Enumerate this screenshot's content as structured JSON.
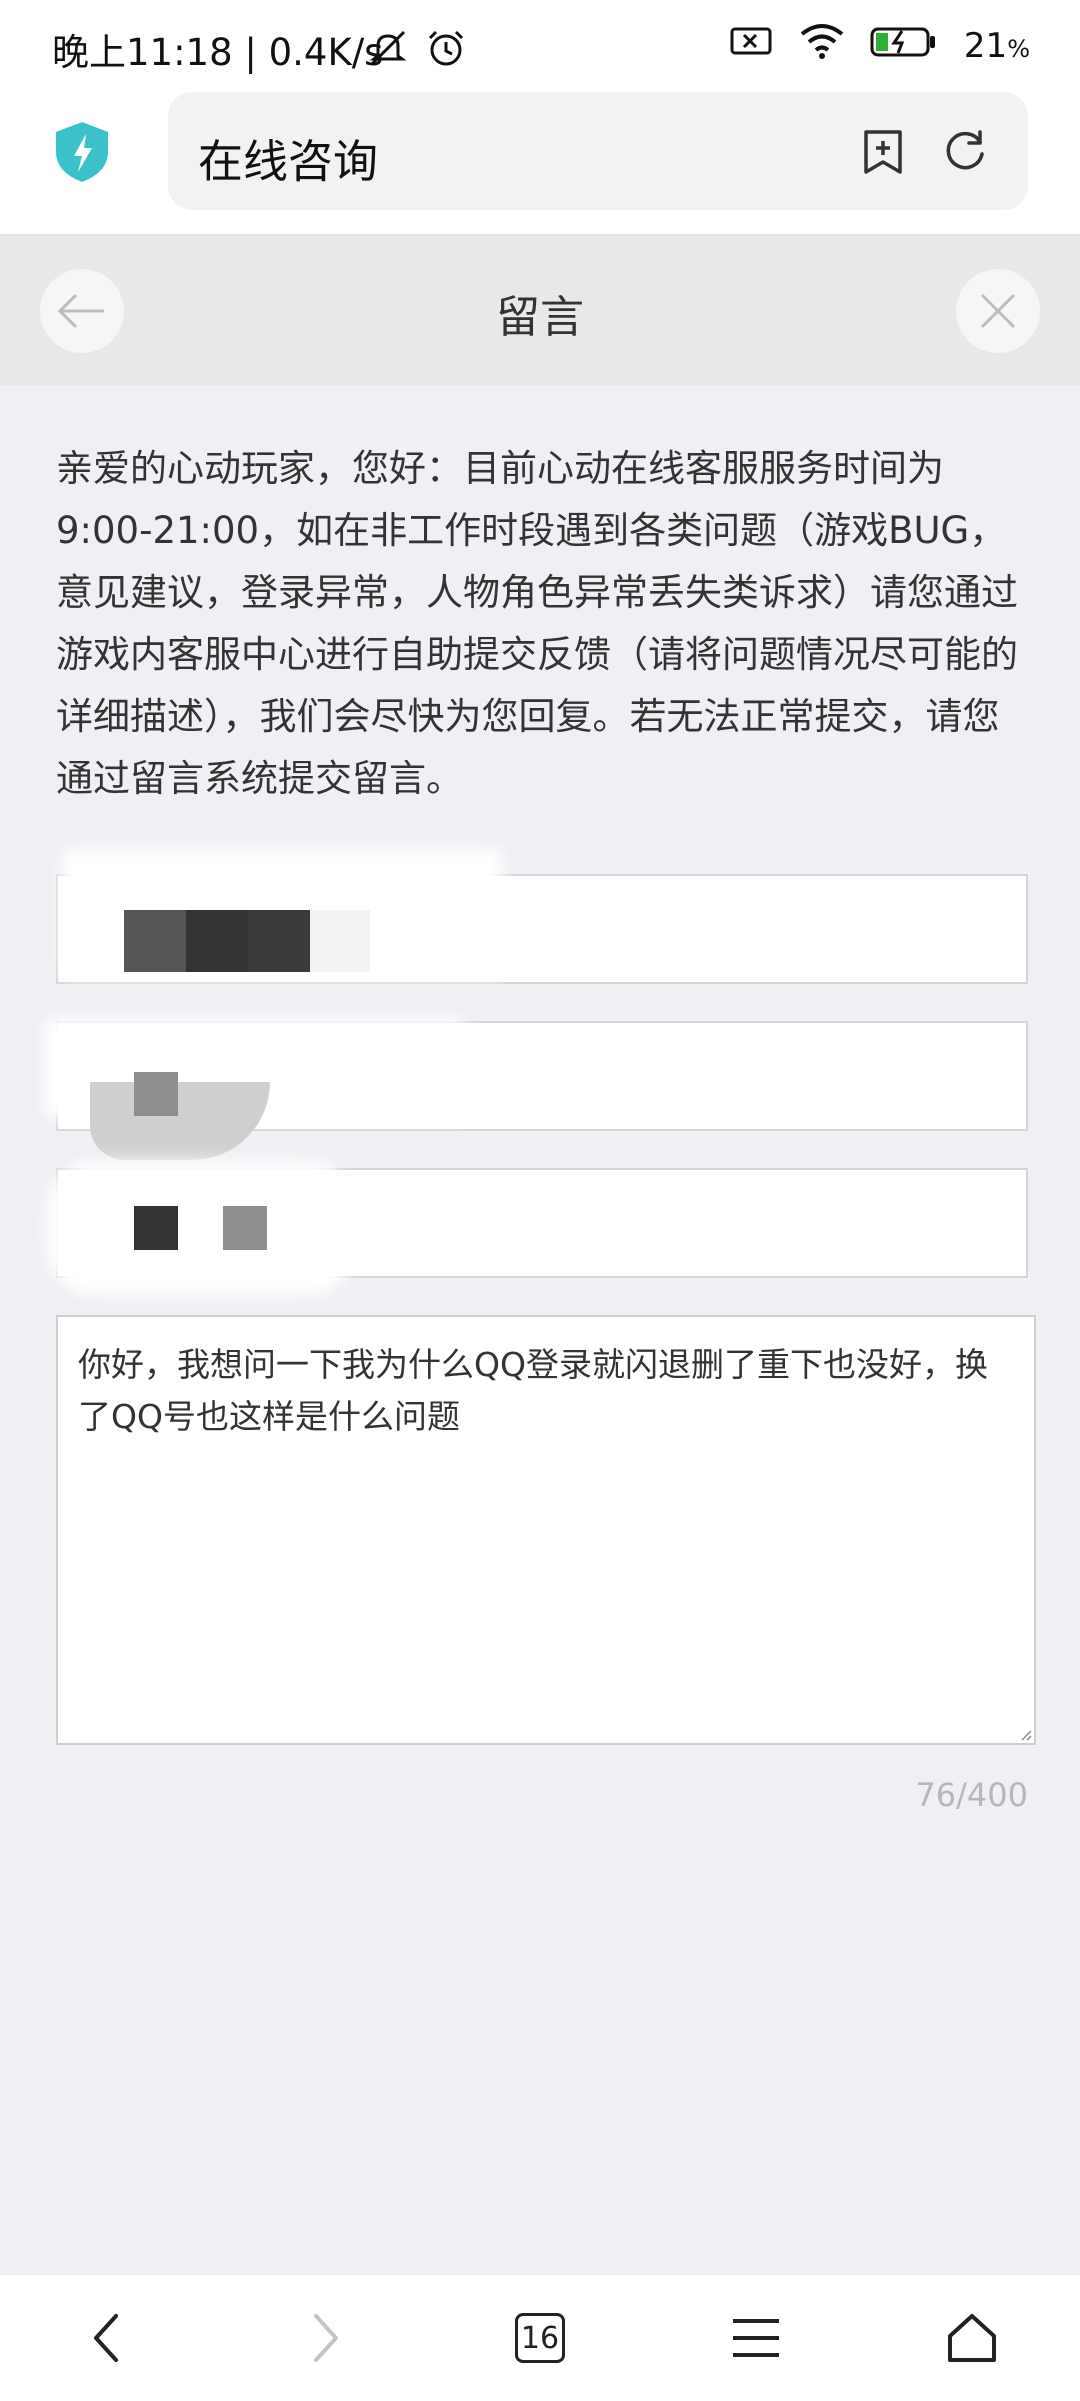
{
  "status_bar": {
    "time_text": "晚上11:18 | 0.4K/s",
    "battery_percent": "21",
    "battery_unit": "%"
  },
  "browser": {
    "page_title": "在线咨询",
    "tab_count": "16"
  },
  "page": {
    "title": "留言",
    "notice": "亲爱的心动玩家，您好：目前心动在线客服服务时间为9:00-21:00，如在非工作时段遇到各类问题（游戏BUG，意见建议，登录异常，人物角色异常丢失类诉求）请您通过游戏内客服中心进行自助提交反馈（请将问题情况尽可能的详细描述），我们会尽快为您回复。若无法正常提交，请您通过留言系统提交留言。"
  },
  "form": {
    "message": "你好，我想问一下我为什么QQ登录就闪退删了重下也没好，换了QQ号也这样是什么问题",
    "counter": "76/400"
  },
  "colors": {
    "accent_shield": "#3cc1c9",
    "background": "#efeff4"
  }
}
